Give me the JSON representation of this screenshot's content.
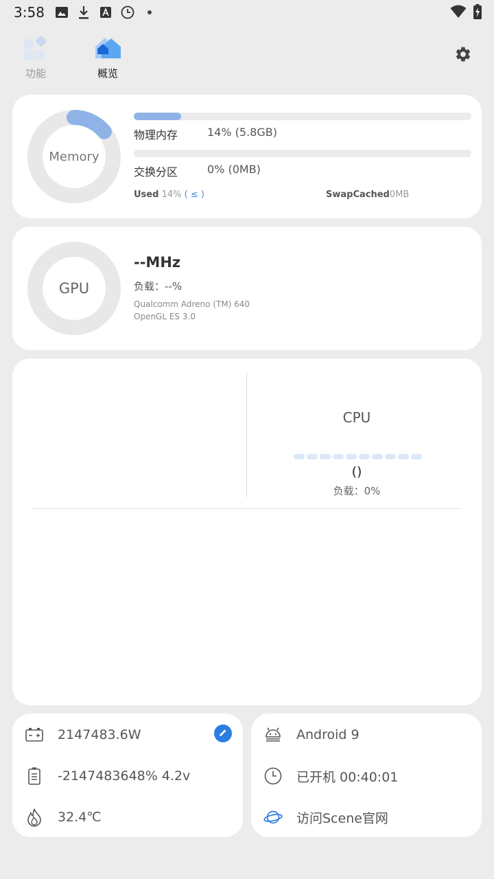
{
  "status_bar": {
    "time": "3:58",
    "icons": [
      "image-icon",
      "download-icon",
      "font-icon",
      "clock-icon",
      "dot-icon"
    ],
    "right_icons": [
      "wifi-icon",
      "battery-charging-icon"
    ]
  },
  "nav": {
    "tabs": [
      {
        "label": "功能",
        "icon": "grid-apps-icon",
        "active": false
      },
      {
        "label": "概览",
        "icon": "home-icon",
        "active": true
      }
    ],
    "settings_icon": "gear-icon"
  },
  "memory": {
    "ring_label": "Memory",
    "ring_percent": 14,
    "physical": {
      "label": "物理内存",
      "value": "14% (5.8GB)",
      "percent": 14
    },
    "swap": {
      "label": "交换分区",
      "value": "0% (0MB)",
      "percent": 0
    },
    "used_label": "Used",
    "used_value": "14%",
    "used_link": "( ≤ )",
    "swapcached_label": "SwapCached",
    "swapcached_value": "0MB"
  },
  "gpu": {
    "ring_label": "GPU",
    "frequency": "--MHz",
    "load": "负载：--%",
    "renderer": "Qualcomm Adreno (TM) 640",
    "api": "OpenGL ES 3.0"
  },
  "cpu": {
    "title": "CPU",
    "core_count": 10,
    "model": "()",
    "load": "负载：0%"
  },
  "power": {
    "power": "2147483.6W",
    "battery": "-2147483648%  4.2v",
    "temperature": "32.4℃"
  },
  "system": {
    "android": "Android 9",
    "uptime": "已开机  00:40:01",
    "website": "访问Scene官网"
  },
  "colors": {
    "accent": "#2a7de1",
    "bar_fill": "#8fb3e6",
    "ring_track": "#e8e8e8",
    "background": "#ececec"
  }
}
